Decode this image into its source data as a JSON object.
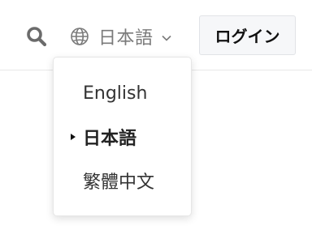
{
  "header": {
    "search_icon": "search-icon",
    "language": {
      "icon": "globe-icon",
      "current_label": "日本語",
      "chevron_icon": "chevron-down-icon"
    },
    "login_label": "ログイン"
  },
  "language_menu": {
    "items": [
      {
        "label": "English",
        "selected": false
      },
      {
        "label": "日本語",
        "selected": true
      },
      {
        "label": "繁體中文",
        "selected": false
      }
    ]
  },
  "colors": {
    "icon_gray": "#6b6b6b",
    "text_gray": "#7a7a7a",
    "login_bg": "#f6f7f9"
  }
}
